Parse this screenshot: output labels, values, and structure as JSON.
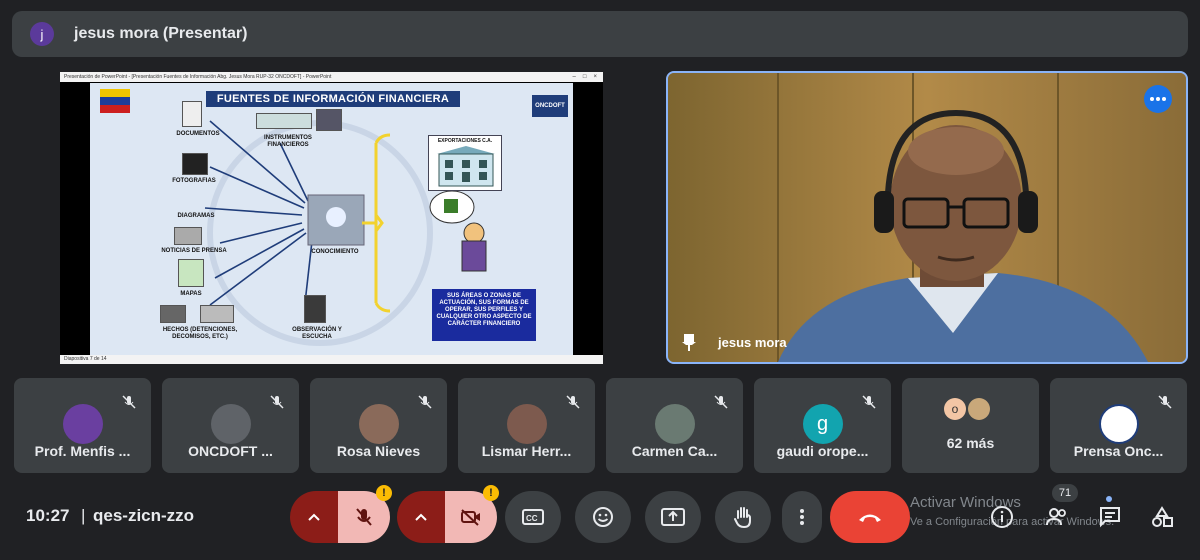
{
  "presenter": {
    "avatar_initial": "j",
    "title": "jesus mora (Presentar)"
  },
  "presentation": {
    "window_title": "Presentación de PowerPoint - [Presentación Fuentes de Información Abg. Jesus Mora RUP-32 ONCDOFT] - PowerPoint",
    "slide_title": "FUENTES DE INFORMACIÓN FINANCIERA",
    "logo_text": "ONCDOFT",
    "labels": {
      "documentos": "DOCUMENTOS",
      "instrumentos": "INSTRUMENTOS FINANCIEROS",
      "fotografias": "FOTOGRAFIAS",
      "diagramas": "DIAGRAMAS",
      "noticias": "NOTICIAS DE PRENSA",
      "mapas": "MAPAS",
      "hechos": "HECHOS (DETENCIONES, DECOMISOS, ETC.)",
      "observacion": "OBSERVACIÓN Y ESCUCHA",
      "conocimiento": "CONOCIMIENTO",
      "exportaciones": "EXPORTACIONES C.A."
    },
    "blue_box_text": "SUS ÁREAS O ZONAS DE ACTUACIÓN, SUS FORMAS DE OPERAR, SUS PERFILES Y CUALQUIER OTRO ASPECTO DE CARÁCTER FINANCIERO",
    "status_text": "Diapositiva 7 de 14"
  },
  "camera": {
    "name": "jesus mora"
  },
  "participants": [
    {
      "name": "Prof. Menfis ...",
      "avatar": "photo",
      "color": "#6a3fa0"
    },
    {
      "name": "ONCDOFT ...",
      "avatar": "logo",
      "color": "#5f6368"
    },
    {
      "name": "Rosa Nieves",
      "avatar": "photo",
      "color": "#8a6a5a"
    },
    {
      "name": "Lismar Herr...",
      "avatar": "photo",
      "color": "#7d5a4e"
    },
    {
      "name": "Carmen Ca...",
      "avatar": "photo",
      "color": "#6a7a72"
    },
    {
      "name": "gaudi orope...",
      "avatar": "letter",
      "letter": "g",
      "color": "#12a4af"
    },
    {
      "name": "62 más",
      "avatar": "group",
      "letter": "o",
      "color": "#f3c6a5"
    },
    {
      "name": "Prensa Onc...",
      "avatar": "logo",
      "color": "#1f3d7a"
    }
  ],
  "bottom": {
    "time": "10:27",
    "separator": "|",
    "meeting_code": "qes-zicn-zzo",
    "warning_mark": "!",
    "participant_count": "71",
    "watermark_title": "Activar Windows",
    "watermark_sub": "Ve a Configuración para activar Windows."
  },
  "colors": {
    "accent": "#8ab4f8",
    "end_call": "#ea4335",
    "mute_bg": "#f2b8b5",
    "mute_chev": "#8c1d18"
  }
}
